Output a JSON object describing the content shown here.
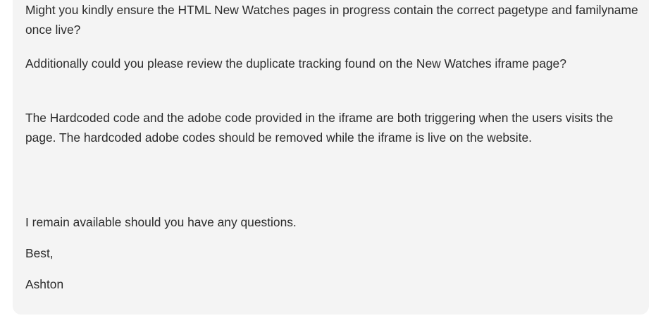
{
  "message": {
    "paragraphs": [
      "Might you kindly ensure the HTML New Watches pages in progress contain the correct pagetype and familyname once live?",
      "Additionally could you please review the duplicate tracking found on the New Watches iframe page?",
      "The Hardcoded code and the adobe code provided in the iframe are both triggering when the users visits the page. The hardcoded adobe codes should be removed while the iframe is live on the website.",
      "I remain available should you have any questions.",
      "Best,",
      "Ashton"
    ]
  }
}
